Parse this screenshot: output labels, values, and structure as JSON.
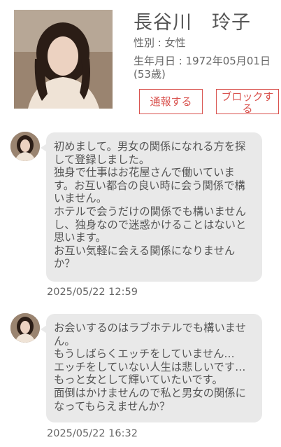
{
  "profile": {
    "name": "長谷川　玲子",
    "gender": "性別 : 女性",
    "birthdate": "生年月日 : 1972年05月01日(53歳)"
  },
  "actions": {
    "report_label": "通報する",
    "block_label": "ブロックする"
  },
  "messages": [
    {
      "text": "初めまして。男女の関係になれる方を探して登録しました。\n独身で仕事はお花屋さんで働いています。お互い都合の良い時に会う関係で構いません。\nホテルで会うだけの関係でも構いませんし、独身なので迷惑かけることはないと思います。\nお互い気軽に会える関係になりませんか？",
      "timestamp": "2025/05/22 12:59"
    },
    {
      "text": "お会いするのはラブホテルでも構いません。\nもうしばらくエッチをしていません…\nエッチをしていない人生は悲しいです…\nもっと女として輝いていたいです。\n面倒はかけませんので私と男女の関係になってもらえませんか？",
      "timestamp": "2025/05/22 16:32"
    }
  ],
  "colors": {
    "accent_red": "#d9534f",
    "bubble_bg": "#e9e9e9",
    "text": "#555555"
  }
}
